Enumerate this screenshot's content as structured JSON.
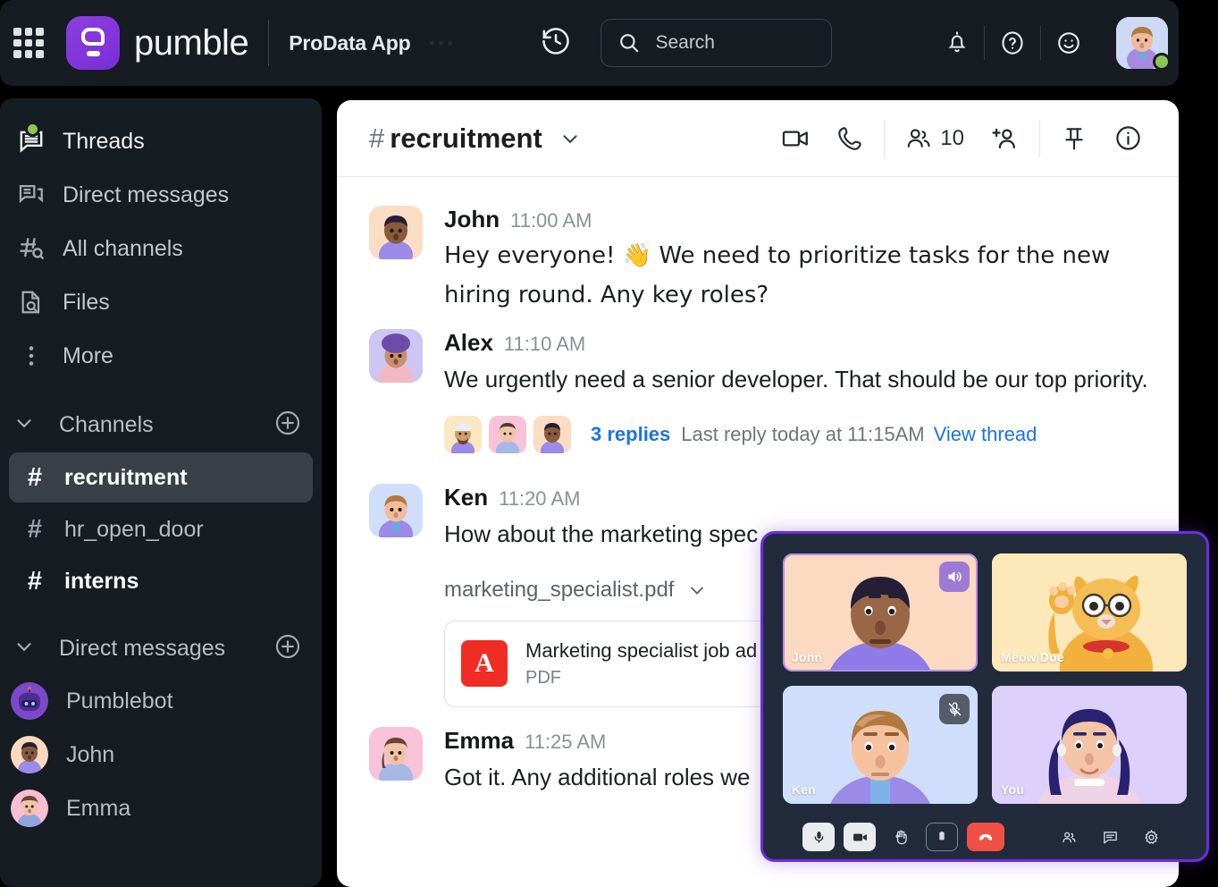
{
  "topbar": {
    "brand_name": "pumble",
    "workspace": "ProData App",
    "search_placeholder": "Search",
    "icons": {
      "apps_grid": "apps-grid-icon",
      "history": "history-icon",
      "search": "search-icon",
      "notifications": "bell-icon",
      "help": "help-circle-icon",
      "emoji_status": "smiley-icon",
      "avatar": "user-avatar"
    }
  },
  "sidebar": {
    "nav": [
      {
        "label": "Threads",
        "icon": "threads-icon"
      },
      {
        "label": "Direct messages",
        "icon": "direct-messages-icon"
      },
      {
        "label": "All channels",
        "icon": "all-channels-icon"
      },
      {
        "label": "Files",
        "icon": "files-icon"
      },
      {
        "label": "More",
        "icon": "more-icon"
      }
    ],
    "channels_section": {
      "label": "Channels",
      "add_label": "+"
    },
    "channels": [
      {
        "name": "recruitment",
        "active": true
      },
      {
        "name": "hr_open_door",
        "active": false
      },
      {
        "name": "interns",
        "active": false
      }
    ],
    "dms_section": {
      "label": "Direct messages",
      "add_label": "+"
    },
    "dms": [
      {
        "name": "Pumblebot",
        "status": "online"
      },
      {
        "name": "John",
        "status": "online"
      },
      {
        "name": "Emma",
        "status": "online"
      }
    ]
  },
  "channel": {
    "hash": "#",
    "name": "recruitment",
    "member_count": "10",
    "actions": [
      "video-call-icon",
      "phone-call-icon",
      "members-icon",
      "add-member-icon",
      "pin-icon",
      "info-icon"
    ]
  },
  "messages": [
    {
      "author": "John",
      "time": "11:00 AM",
      "text": "Hey everyone! 👋 We need to prioritize tasks for the new hiring round. Any key roles?"
    },
    {
      "author": "Alex",
      "time": "11:10 AM",
      "text": "We urgently need a senior developer. That should be our top priority.",
      "thread": {
        "replies": "3 replies",
        "last_reply": "Last reply today at 11:15AM",
        "view": "View thread"
      }
    },
    {
      "author": "Ken",
      "time": "11:20 AM",
      "text": "How about the marketing spec",
      "attachment": {
        "filename": "marketing_specialist.pdf",
        "card_title": "Marketing specialist job ad",
        "card_type": "PDF",
        "icon": "pdf-icon"
      }
    },
    {
      "author": "Emma",
      "time": "11:25 AM",
      "text": "Got it. Any additional roles we"
    }
  ],
  "call": {
    "participants": [
      {
        "name": "John",
        "badge": "audio-on",
        "speaking": true
      },
      {
        "name": "Meow Doe",
        "badge": "",
        "speaking": false
      },
      {
        "name": "Ken",
        "badge": "mic-muted",
        "speaking": false
      },
      {
        "name": "You",
        "badge": "",
        "speaking": false
      }
    ],
    "controls": [
      {
        "name": "microphone-button",
        "icon": "mic-icon"
      },
      {
        "name": "camera-button",
        "icon": "camera-icon"
      },
      {
        "name": "raise-hand-button",
        "icon": "hand-icon"
      },
      {
        "name": "share-screen-button",
        "icon": "share-screen-icon"
      },
      {
        "name": "end-call-button",
        "icon": "phone-hangup-icon"
      },
      {
        "name": "participants-button",
        "icon": "people-icon"
      },
      {
        "name": "chat-button",
        "icon": "chat-bubble-icon"
      },
      {
        "name": "settings-button",
        "icon": "gear-icon"
      }
    ]
  },
  "colors": {
    "brand_purple": "#7a2fd6",
    "call_border": "#6c2ee0",
    "link_blue": "#1b72e8",
    "presence_green": "#8ec556",
    "pdf_red": "#ef2d24"
  }
}
